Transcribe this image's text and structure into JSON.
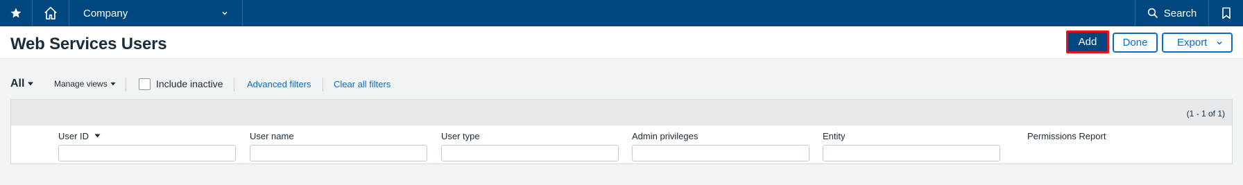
{
  "nav": {
    "company_label": "Company",
    "search_label": "Search"
  },
  "header": {
    "title": "Web Services Users",
    "add_label": "Add",
    "done_label": "Done",
    "export_label": "Export"
  },
  "filters": {
    "view_label": "All",
    "manage_views_label": "Manage views",
    "include_inactive_label": "Include inactive",
    "include_inactive_checked": false,
    "advanced_filters_label": "Advanced filters",
    "clear_filters_label": "Clear all filters"
  },
  "table": {
    "count_text": "(1 - 1 of 1)",
    "columns": [
      {
        "label": "User ID",
        "sortable": true,
        "value": ""
      },
      {
        "label": "User name",
        "value": ""
      },
      {
        "label": "User type",
        "value": ""
      },
      {
        "label": "Admin privileges",
        "value": ""
      },
      {
        "label": "Entity",
        "value": ""
      },
      {
        "label": "Permissions Report"
      }
    ]
  },
  "colors": {
    "nav_bg": "#00467f",
    "primary": "#00467f",
    "link": "#0a6cc2",
    "highlight": "#e0121b"
  }
}
